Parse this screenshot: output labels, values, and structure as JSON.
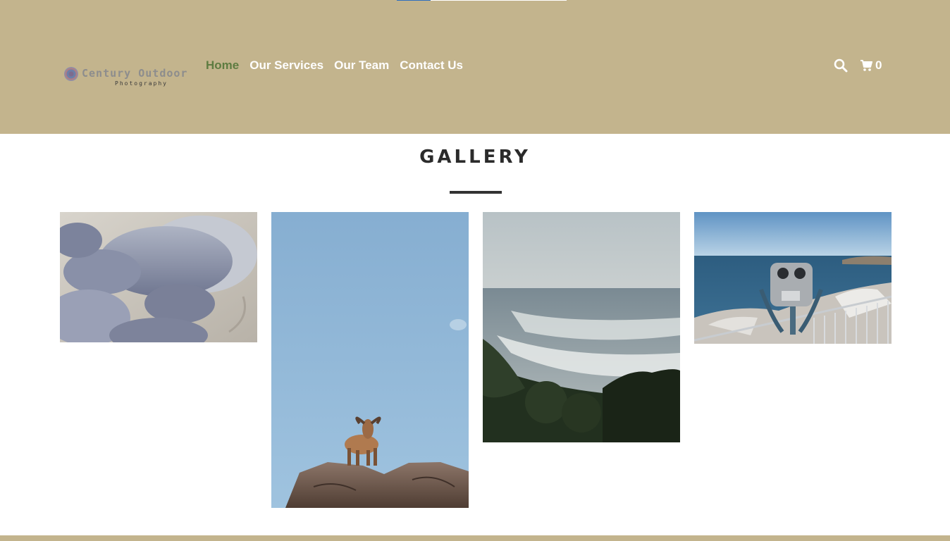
{
  "header": {
    "logo": {
      "title": "Century Outdoor",
      "subtitle": "Photography"
    },
    "nav": {
      "home": "Home",
      "services": "Our Services",
      "team": "Our Team",
      "contact": "Contact Us"
    },
    "tools": {
      "search_icon": "search-icon",
      "cart_icon": "cart-icon",
      "cart_count": "0"
    },
    "progress": {
      "fraction": 0.2
    }
  },
  "gallery": {
    "title": "GALLERY",
    "photos": [
      {
        "subject": "elephant seals resting on sand"
      },
      {
        "subject": "mountain goat on a rock against blue sky"
      },
      {
        "subject": "ocean coastline with trees"
      },
      {
        "subject": "coin-operated binoculars by the sea"
      }
    ]
  },
  "colors": {
    "header_bg": "#c3b48d",
    "nav_active": "#5e7c41",
    "nav_text": "#ffffff",
    "title_text": "#2b2b2b"
  }
}
